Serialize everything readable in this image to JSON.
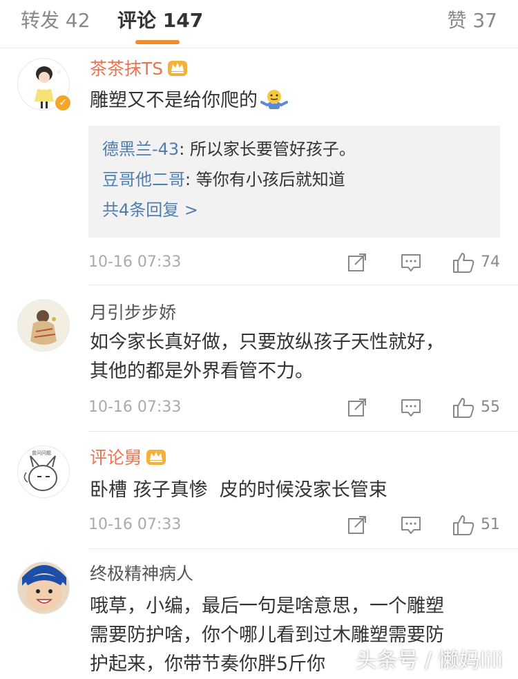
{
  "tabs": {
    "reposts": "转发 42",
    "comments": "评论 147",
    "likes": "赞 37"
  },
  "comments": [
    {
      "name": "茶茶抹TS",
      "vip": true,
      "verified": true,
      "text": "雕塑又不是给你爬的",
      "emoji": "shrug-emoji",
      "replies": [
        {
          "name": "德黑兰-43",
          "text": ": 所以家长要管好孩子。"
        },
        {
          "name": "豆哥他二哥",
          "text": ": 等你有小孩后就知道"
        }
      ],
      "more_replies": "共4条回复 >",
      "time": "10-16 07:33",
      "likes": "74"
    },
    {
      "name": "月引步步娇",
      "vip": false,
      "text_lines": [
        "如今家长真好做，只要放纵孩子天性就好，",
        "其他的都是外界看管不力。"
      ],
      "time": "10-16 07:33",
      "likes": "55"
    },
    {
      "name": "评论舅",
      "vip": true,
      "text": "卧槽 孩子真惨  皮的时候没家长管束",
      "time": "10-16 07:33",
      "likes": "51"
    },
    {
      "name": "终极精神病人",
      "vip": false,
      "text_lines": [
        "哦草，小编，最后一句是啥意思，一个雕塑",
        "需要防护啥，你个哪儿看到过木雕塑需要防",
        "护起来，你带节奏你胖5斤你"
      ]
    }
  ],
  "watermark": "头条号 / 懒妈lili",
  "colors": {
    "accent_orange": "#f08a2a",
    "vip_name": "#eb7350",
    "reply_link": "#507daf",
    "reply_bg": "#f2f2f2"
  }
}
